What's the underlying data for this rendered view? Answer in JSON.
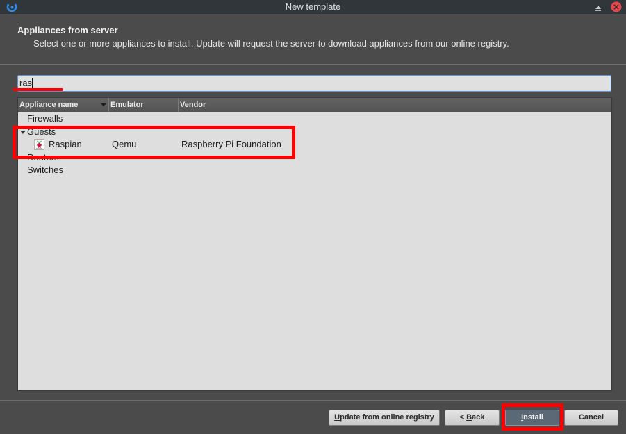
{
  "window": {
    "title": "New template",
    "icons": {
      "app": "gns3-logo-icon",
      "keep_above": "keep-above-icon",
      "close": "close-icon"
    }
  },
  "header": {
    "title": "Appliances from server",
    "description": "Select one or more appliances to install. Update will request the server to download appliances from our online registry."
  },
  "search": {
    "value": "ras",
    "focused": true
  },
  "tree": {
    "columns": [
      {
        "label": "Appliance name",
        "sort": "descending"
      },
      {
        "label": "Emulator"
      },
      {
        "label": "Vendor"
      }
    ],
    "categories": [
      {
        "name": "Firewalls",
        "expanded": false
      },
      {
        "name": "Guests",
        "expanded": true,
        "children": [
          {
            "name": "Raspian",
            "emulator": "Qemu",
            "vendor": "Raspberry Pi Foundation",
            "icon": "raspberry-pi-icon"
          }
        ]
      },
      {
        "name": "Routers",
        "expanded": false
      },
      {
        "name": "Switches",
        "expanded": false
      }
    ]
  },
  "buttons": {
    "update": {
      "mnemonic": "U",
      "rest": "pdate from online registry"
    },
    "back": {
      "prefix": "< ",
      "mnemonic": "B",
      "rest": "ack"
    },
    "install": {
      "mnemonic": "I",
      "rest": "nstall",
      "default": true
    },
    "cancel": {
      "label": "Cancel"
    }
  },
  "colors": {
    "title_bar": "#31363b",
    "dialog_background": "#4b4b4b",
    "list_background": "#dedede",
    "focus_border": "#5294e2",
    "install_button": "#5b6977",
    "close_button": "#e5484d",
    "annotation": "#ff0000"
  }
}
